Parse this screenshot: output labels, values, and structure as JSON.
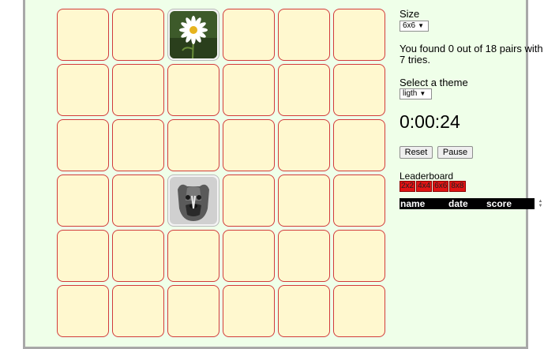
{
  "board": {
    "rows": 6,
    "cols": 6,
    "revealed": [
      {
        "index": 2,
        "image": "daisy-flower-photo"
      },
      {
        "index": 20,
        "image": "boxer-dog-photo"
      }
    ]
  },
  "size": {
    "label": "Size",
    "value": "6x6"
  },
  "status": {
    "line1": "You found 0 out of 18 pairs with",
    "line2": "7 tries."
  },
  "theme": {
    "label": "Select a theme",
    "value": "ligth"
  },
  "timer": "0:00:24",
  "buttons": {
    "reset": "Reset",
    "pause": "Pause"
  },
  "leaderboard": {
    "title": "Leaderboard",
    "tabs": [
      "2x2",
      "4x4",
      "6x6",
      "8x8"
    ],
    "columns": [
      "name",
      "date",
      "score"
    ]
  },
  "colors": {
    "card_face": "#fff8cf",
    "card_border": "#d23b3b",
    "panel_bg": "#efffe9",
    "tab_bg": "#e01414"
  }
}
